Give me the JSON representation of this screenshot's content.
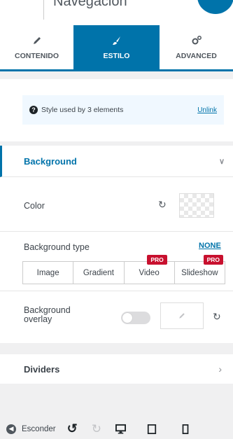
{
  "header": {
    "title": "Navegación"
  },
  "tabs": [
    {
      "label": "CONTENIDO",
      "icon": "pencil-icon",
      "active": false
    },
    {
      "label": "ESTILO",
      "icon": "brush-icon",
      "active": true
    },
    {
      "label": "ADVANCED",
      "icon": "gears-icon",
      "active": false
    }
  ],
  "notice": {
    "text": "Style used by 3 elements",
    "link": "Unlink",
    "icon": "question-circle-icon"
  },
  "background_section": {
    "title": "Background",
    "expanded": true
  },
  "color": {
    "label": "Color",
    "value": "transparent"
  },
  "background_type": {
    "label": "Background type",
    "reset_label": "NONE",
    "options": [
      {
        "label": "Image",
        "pro": false
      },
      {
        "label": "Gradient",
        "pro": false
      },
      {
        "label": "Video",
        "pro": true
      },
      {
        "label": "Slideshow",
        "pro": true
      }
    ],
    "pro_badge": "PRO"
  },
  "overlay": {
    "label": "Background overlay",
    "enabled": false
  },
  "dividers": {
    "label": "Dividers"
  },
  "footer": {
    "hide_label": "Esconder"
  },
  "colors": {
    "accent": "#0073aa",
    "pro": "#c8102e"
  }
}
